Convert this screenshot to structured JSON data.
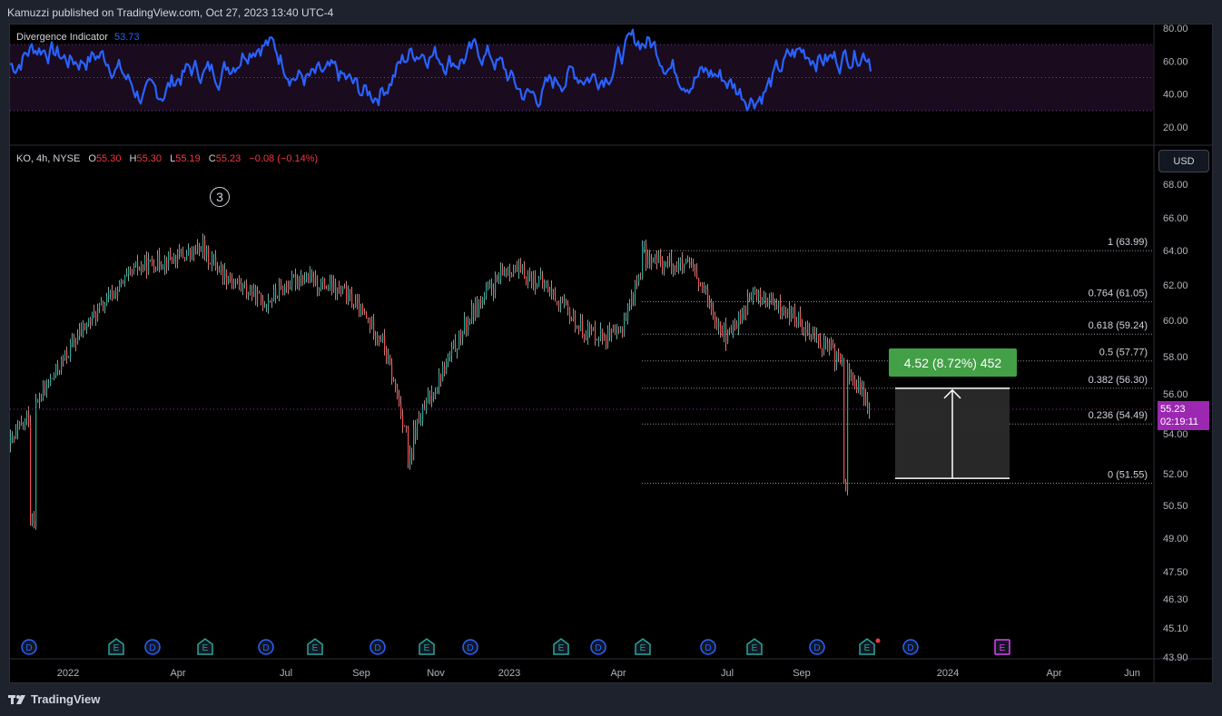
{
  "header": {
    "published": "Kamuzzi published on TradingView.com, Oct 27, 2023 13:40 UTC-4"
  },
  "footer": {
    "brand": "TradingView"
  },
  "indicator": {
    "name": "Divergence Indicator",
    "value": "53.73",
    "color": "#2962ff",
    "ticks": [
      "80.00",
      "60.00",
      "40.00",
      "20.00"
    ]
  },
  "symbol": {
    "name": "KO, 4h, NYSE",
    "o_label": "O",
    "o": "55.30",
    "h_label": "H",
    "h": "55.30",
    "l_label": "L",
    "l": "55.19",
    "c_label": "C",
    "c": "55.23",
    "change": "−0.08 (−0.14%)"
  },
  "currency": "USD",
  "last_price": {
    "value": "55.23",
    "countdown": "02:19:11",
    "color": "#9c27b0"
  },
  "wave_label": "3",
  "measure": {
    "label": "4.52 (8.72%) 452",
    "color": "#43a047"
  },
  "price_ticks": [
    "68.00",
    "66.00",
    "64.00",
    "62.00",
    "60.00",
    "58.00",
    "56.00",
    "54.00",
    "52.00",
    "50.50",
    "49.00",
    "47.50",
    "46.30",
    "45.10",
    "43.90"
  ],
  "time_ticks": [
    "2022",
    "Apr",
    "Jul",
    "Sep",
    "Nov",
    "2023",
    "Apr",
    "Jul",
    "Sep",
    "2024",
    "Apr",
    "Jun"
  ],
  "fib_levels": [
    {
      "label": "1 (63.99)",
      "price": 63.99
    },
    {
      "label": "0.764 (61.05)",
      "price": 61.05
    },
    {
      "label": "0.618 (59.24)",
      "price": 59.24
    },
    {
      "label": "0.5 (57.77)",
      "price": 57.77
    },
    {
      "label": "0.382 (56.30)",
      "price": 56.3
    },
    {
      "label": "0.236 (54.49)",
      "price": 54.49
    },
    {
      "label": "0 (51.55)",
      "price": 51.55
    }
  ],
  "events": [
    "D",
    "E",
    "D",
    "E",
    "D",
    "E",
    "D",
    "E",
    "D",
    "E",
    "D",
    "E",
    "D",
    "E",
    "D",
    "E",
    "D",
    "E"
  ],
  "chart_data": [
    {
      "type": "line",
      "title": "Divergence Indicator",
      "series": [
        {
          "name": "Divergence Indicator",
          "last": 53.73
        }
      ],
      "ylim": [
        10,
        85
      ],
      "levels": [
        70,
        50,
        30
      ]
    },
    {
      "type": "candlestick",
      "title": "KO, 4h, NYSE",
      "x": [
        "2021-12",
        "2022-01",
        "2022-02",
        "2022-03",
        "2022-04",
        "2022-05",
        "2022-06",
        "2022-07",
        "2022-08",
        "2022-09",
        "2022-10",
        "2022-11",
        "2022-12",
        "2023-01",
        "2023-02",
        "2023-03",
        "2023-04",
        "2023-05",
        "2023-06",
        "2023-07",
        "2023-08",
        "2023-09",
        "2023-10"
      ],
      "series": [
        {
          "name": "KO",
          "values": [
            53.5,
            55.5,
            59.5,
            63.0,
            64.0,
            62.5,
            61.0,
            62.5,
            61.5,
            59.0,
            53.5,
            60.5,
            63.0,
            62.0,
            59.5,
            59.0,
            63.5,
            63.0,
            59.0,
            61.5,
            60.0,
            57.5,
            55.23
          ]
        }
      ],
      "low_min": 49.9,
      "high_max": 64.4,
      "ylabel": "USD"
    }
  ]
}
